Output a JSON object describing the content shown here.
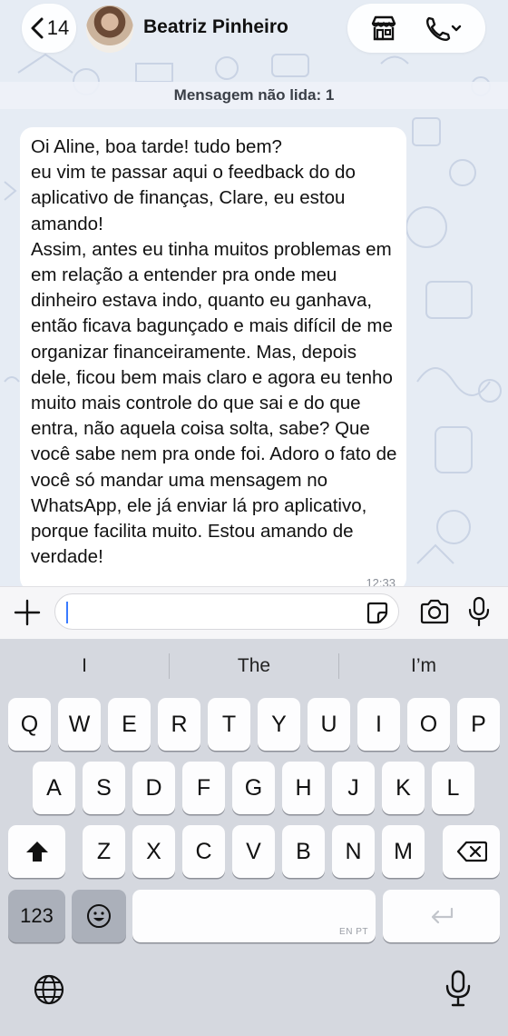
{
  "header": {
    "back_count": "14",
    "contact_name": "Beatriz Pinheiro"
  },
  "chat": {
    "unread_banner": "Mensagem não lida: 1",
    "message": {
      "text": "Oi Aline, boa tarde! tudo bem?\neu vim te passar aqui o feedback do do aplicativo de finanças, Clare, eu estou amando!\nAssim, antes eu tinha muitos problemas em em relação a entender pra onde meu dinheiro estava indo, quanto eu ganhava, então ficava bagunçado e mais difícil de me organizar financeiramente. Mas, depois dele, ficou bem mais claro e agora eu tenho muito mais controle do que sai e do que entra, não aquela coisa solta, sabe? Que você sabe nem pra onde foi. Adoro o fato de você só mandar uma mensagem no WhatsApp, ele já enviar lá pro aplicativo, porque facilita muito. Estou amando de verdade!",
      "time": "12:33"
    }
  },
  "composer": {
    "value": ""
  },
  "keyboard": {
    "suggestions": [
      "I",
      "The",
      "I’m"
    ],
    "row1": [
      "Q",
      "W",
      "E",
      "R",
      "T",
      "Y",
      "U",
      "I",
      "O",
      "P"
    ],
    "row2": [
      "A",
      "S",
      "D",
      "F",
      "G",
      "H",
      "J",
      "K",
      "L"
    ],
    "row3": [
      "Z",
      "X",
      "C",
      "V",
      "B",
      "N",
      "M"
    ],
    "numbers_label": "123",
    "space_lang_label": "EN PT"
  },
  "colors": {
    "chat_background": "#e6ecf4",
    "bubble": "#ffffff",
    "keyboard_background": "#d5d8df",
    "caret": "#3a7bff"
  }
}
